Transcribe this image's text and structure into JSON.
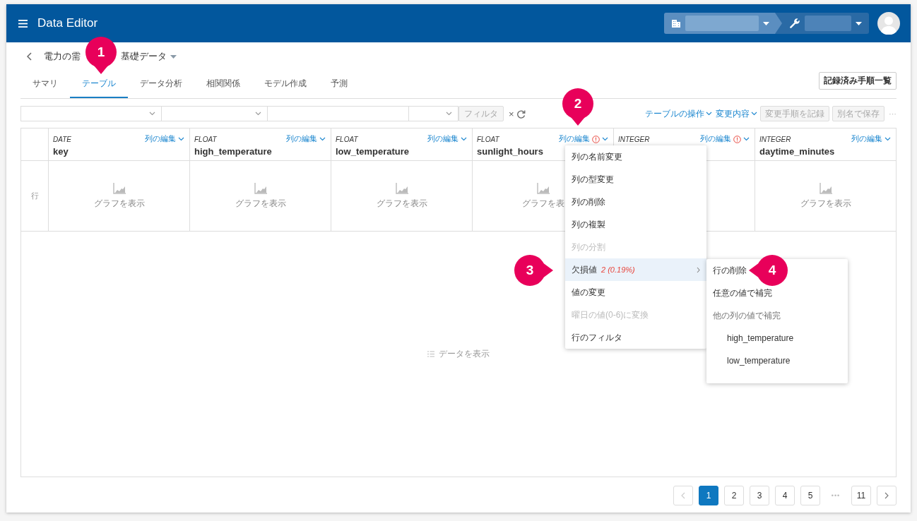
{
  "app": {
    "title": "Data Editor"
  },
  "header_selectors": [
    {
      "kind": "organization"
    },
    {
      "kind": "tool"
    }
  ],
  "dataset": {
    "title_parts": [
      "電力の需",
      "基礎データ"
    ]
  },
  "tabs": [
    {
      "label": "サマリ",
      "selected": false
    },
    {
      "label": "テーブル",
      "selected": true
    },
    {
      "label": "データ分析",
      "selected": false
    },
    {
      "label": "相関関係",
      "selected": false
    },
    {
      "label": "モデル作成",
      "selected": false
    },
    {
      "label": "予測",
      "selected": false
    }
  ],
  "history_button": {
    "label": "記録済み手順一覧"
  },
  "filter_fields": [
    {
      "kind": "select"
    },
    {
      "kind": "select"
    },
    {
      "kind": "text"
    },
    {
      "kind": "select"
    }
  ],
  "filter_button": {
    "label": "フィルタ",
    "disabled": true
  },
  "clear_filter": {
    "label": "×"
  },
  "table_actions": [
    {
      "kind": "menu",
      "label": "テーブルの操作"
    },
    {
      "kind": "menu",
      "label": "変更内容"
    },
    {
      "kind": "button",
      "label": "変更手順を記録",
      "disabled": true
    },
    {
      "kind": "button",
      "label": "別名で保存",
      "disabled": true
    },
    {
      "kind": "more",
      "label": "···"
    }
  ],
  "table": {
    "row_label": "行",
    "columns": [
      {
        "type": "DATE",
        "name": "key",
        "edit_label": "列の編集",
        "warning": false,
        "graph_label": "グラフを表示"
      },
      {
        "type": "FLOAT",
        "name": "high_temperature",
        "edit_label": "列の編集",
        "warning": false,
        "graph_label": "グラフを表示"
      },
      {
        "type": "FLOAT",
        "name": "low_temperature",
        "edit_label": "列の編集",
        "warning": false,
        "graph_label": "グラフを表示"
      },
      {
        "type": "FLOAT",
        "name": "sunlight_hours",
        "edit_label": "列の編集",
        "warning": true,
        "graph_label": "グラフを表"
      },
      {
        "type": "INTEGER",
        "edit_label": "列の編集",
        "warning": true
      },
      {
        "type": "INTEGER",
        "name": "daytime_minutes",
        "edit_label": "列の編集",
        "warning": false,
        "graph_label": "グラフを表示"
      }
    ],
    "show_data": {
      "label": "データを表示"
    }
  },
  "column_menu": {
    "items": [
      {
        "label": "列の名前変更",
        "disabled": false,
        "highlighted": false
      },
      {
        "label": "列の型変更",
        "disabled": false,
        "highlighted": false
      },
      {
        "label": "列の削除",
        "disabled": false,
        "highlighted": false
      },
      {
        "label": "列の複製",
        "disabled": false,
        "highlighted": false
      },
      {
        "label": "列の分割",
        "disabled": true,
        "highlighted": false
      },
      {
        "label": "欠損値",
        "count": "2 (0.19%)",
        "has_submenu": true,
        "disabled": false,
        "highlighted": true
      },
      {
        "label": "値の変更",
        "disabled": false,
        "highlighted": false
      },
      {
        "label": "曜日の値(0-6)に変換",
        "disabled": true,
        "highlighted": false
      },
      {
        "label": "行のフィルタ",
        "disabled": false,
        "highlighted": false
      }
    ]
  },
  "missing_value_menu": {
    "items": [
      {
        "label": "行の削除",
        "disabled": false
      },
      {
        "label": "任意の値で補完",
        "disabled": false
      },
      {
        "label": "他の列の値で補完",
        "disabled": true,
        "children": [
          {
            "label": "high_temperature"
          },
          {
            "label": "low_temperature"
          }
        ]
      }
    ]
  },
  "pagination": {
    "previous": {
      "disabled": true
    },
    "pages": [
      {
        "kind": "page",
        "label": "1",
        "selected": true
      },
      {
        "kind": "page",
        "label": "2",
        "selected": false
      },
      {
        "kind": "page",
        "label": "3",
        "selected": false
      },
      {
        "kind": "page",
        "label": "4",
        "selected": false
      },
      {
        "kind": "page",
        "label": "5",
        "selected": false
      },
      {
        "kind": "ellipsis",
        "label": "•••"
      },
      {
        "kind": "page",
        "label": "11",
        "selected": false
      }
    ],
    "next": {
      "disabled": false
    }
  },
  "callouts": [
    {
      "number": "1",
      "kind": "down"
    },
    {
      "number": "2",
      "kind": "down"
    },
    {
      "number": "3",
      "kind": "right"
    },
    {
      "number": "4",
      "kind": "left"
    }
  ]
}
